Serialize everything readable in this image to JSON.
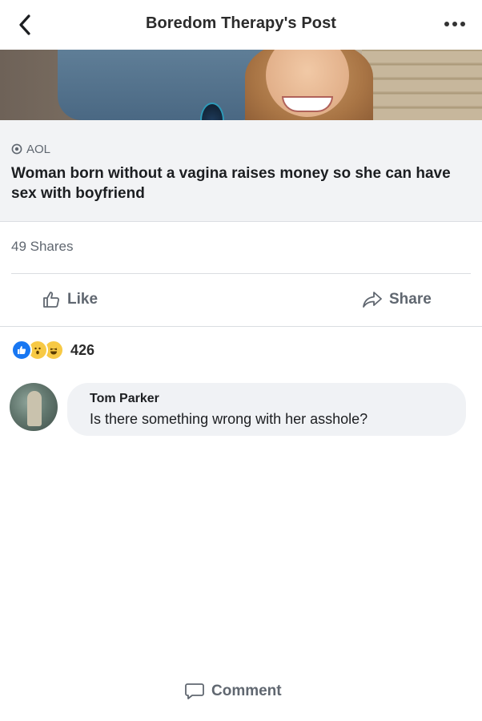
{
  "header": {
    "title": "Boredom Therapy's Post",
    "back_icon": "chevron-left-icon",
    "more_icon": "more-horizontal-icon"
  },
  "link_preview": {
    "source": "AOL",
    "headline": "Woman born without a vagina raises money so she can have sex with boyfriend"
  },
  "stats": {
    "shares": "49 Shares"
  },
  "actions": {
    "like_label": "Like",
    "comment_label": "Comment",
    "share_label": "Share"
  },
  "reactions": {
    "types": [
      "like",
      "wow",
      "haha"
    ],
    "count": "426"
  },
  "comment": {
    "author": "Tom Parker",
    "text": "Is there something wrong with her asshole?"
  },
  "colors": {
    "accent": "#1877f2",
    "muted_text": "#606770",
    "card_bg": "#f2f3f5",
    "bubble_bg": "#f0f2f5"
  }
}
